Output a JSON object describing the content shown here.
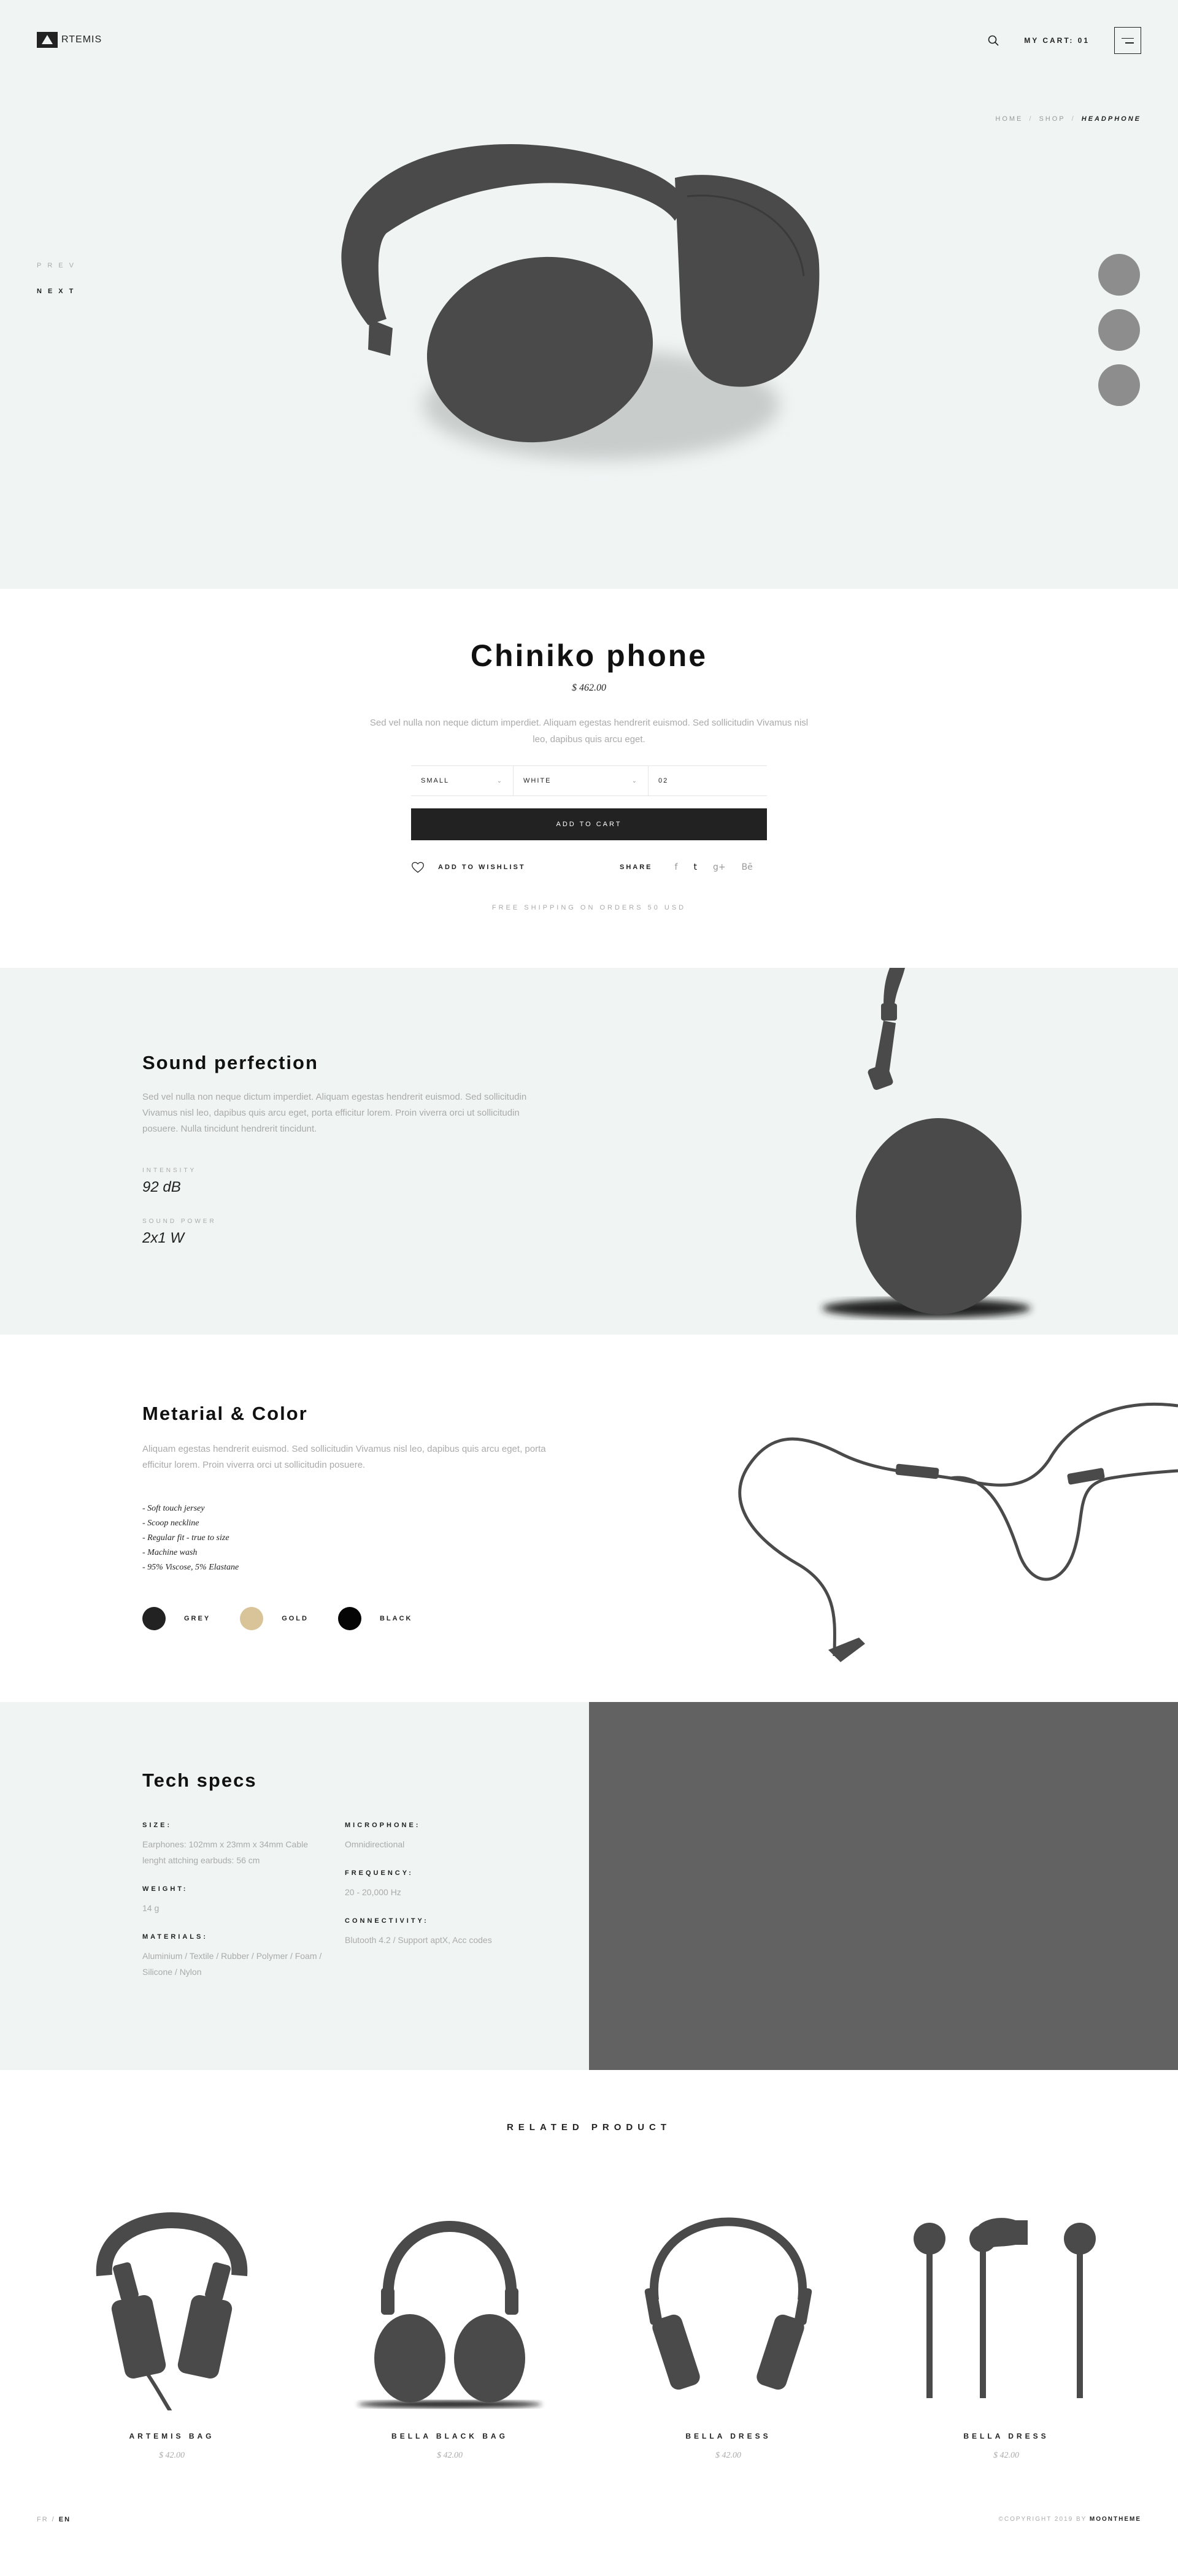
{
  "header": {
    "logo_text": "RTEMIS",
    "cart_label": "MY CART: 01"
  },
  "breadcrumb": {
    "home": "HOME",
    "shop": "SHOP",
    "current": "HEADPHONE",
    "separator": "/"
  },
  "pager": {
    "prev": "PREV",
    "next": "NEXT"
  },
  "product": {
    "title": "Chiniko phone",
    "price": "$ 462.00",
    "description": "Sed vel nulla non neque dictum imperdiet. Aliquam egestas hendrerit euismod. Sed sollicitudin Vivamus nisl leo, dapibus quis arcu eget.",
    "size": "SMALL",
    "color": "WHITE",
    "quantity": "02",
    "add_to_cart": "ADD TO CART",
    "wishlist": "ADD TO WISHLIST",
    "share": "SHARE",
    "social": [
      "f",
      "t",
      "g+",
      "Bē"
    ],
    "shipping": "FREE SHIPPING ON ORDERS 50 USD"
  },
  "sound": {
    "title": "Sound perfection",
    "description": "Sed vel nulla non neque dictum imperdiet. Aliquam egestas hendrerit euismod. Sed sollicitudin Vivamus nisl leo, dapibus quis arcu eget, porta efficitur lorem. Proin viverra orci ut sollicitudin posuere. Nulla tincidunt hendrerit tincidunt.",
    "intensity_label": "INTENSITY",
    "intensity_value": "92 dB",
    "power_label": "SOUND POWER",
    "power_value": "2x1 W"
  },
  "material": {
    "title": "Metarial & Color",
    "description": "Aliquam egestas hendrerit euismod. Sed sollicitudin Vivamus nisl leo, dapibus quis arcu eget, porta efficitur lorem. Proin viverra orci ut sollicitudin posuere.",
    "features": [
      "- Soft touch jersey",
      "- Scoop neckline",
      "- Regular fit - true to size",
      "- Machine wash",
      "- 95% Viscose, 5% Elastane"
    ],
    "swatches": [
      {
        "label": "GREY",
        "color": "#222222"
      },
      {
        "label": "GOLD",
        "color": "#d9c49a"
      },
      {
        "label": "BLACK",
        "color": "#050505"
      }
    ]
  },
  "tech": {
    "title": "Tech specs",
    "size_label": "SIZE:",
    "size_value": "Earphones: 102mm x 23mm x 34mm Cable lenght attching earbuds: 56 cm",
    "weight_label": "WEIGHT:",
    "weight_value": "14 g",
    "materials_label": "MATERIALS:",
    "materials_value": "Aluminium / Textile / Rubber / Polymer / Foam / Silicone / Nylon",
    "microphone_label": "MICROPHONE:",
    "microphone_value": "Omnidirectional",
    "frequency_label": "FREQUENCY:",
    "frequency_value": "20 - 20,000 Hz",
    "connectivity_label": "CONNECTIVITY:",
    "connectivity_value": "Blutooth 4.2 / Support aptX, Acc codes"
  },
  "related": {
    "title": "RELATED PRODUCT",
    "items": [
      {
        "name": "ARTEMIS BAG",
        "price": "$ 42.00"
      },
      {
        "name": "BELLA BLACK BAG",
        "price": "$ 42.00"
      },
      {
        "name": "BELLA DRESS",
        "price": "$ 42.00"
      },
      {
        "name": "BELLA DRESS",
        "price": "$ 42.00"
      }
    ]
  },
  "footer": {
    "lang_fr": "FR",
    "lang_sep": "/",
    "lang_en": "EN",
    "copyright_prefix": "©COPYRIGHT 2019 BY",
    "copyright_brand": "MOONTHEME"
  },
  "colors": {
    "hero_bg": "#f0f5f4",
    "dark": "#222222",
    "product_gray": "#4a4a4a",
    "specs_panel": "#626262"
  }
}
